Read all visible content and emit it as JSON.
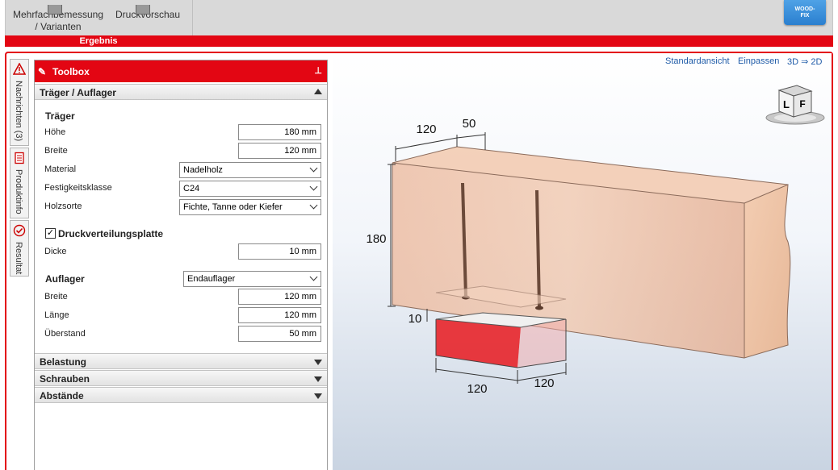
{
  "ribbon": {
    "btn_multi_line1": "Mehrfachbemessung",
    "btn_multi_line2": "/ Varianten",
    "btn_print": "Druckvorschau",
    "group_label": "Ergebnis",
    "brand_line1": "WOOD-",
    "brand_line2": "FIX"
  },
  "side_tabs": [
    {
      "label": "Nachrichten (3)",
      "icon": "warning-icon"
    },
    {
      "label": "Produktinfo",
      "icon": "document-icon"
    },
    {
      "label": "Resultat",
      "icon": "check-icon"
    }
  ],
  "toolbox": {
    "title": "Toolbox",
    "section_traeger": "Träger / Auflager",
    "traeger_heading": "Träger",
    "hoehe_label": "Höhe",
    "hoehe_value": "180 mm",
    "breite_label": "Breite",
    "breite_value": "120 mm",
    "material_label": "Material",
    "material_value": "Nadelholz",
    "festigkeit_label": "Festigkeitsklasse",
    "festigkeit_value": "C24",
    "holzsorte_label": "Holzsorte",
    "holzsorte_value": "Fichte, Tanne oder Kiefer",
    "dvp_label": "Druckverteilungsplatte",
    "dvp_checked": "✓",
    "dicke_label": "Dicke",
    "dicke_value": "10 mm",
    "auflager_heading": "Auflager",
    "auflager_value": "Endauflager",
    "a_breite_label": "Breite",
    "a_breite_value": "120 mm",
    "a_laenge_label": "Länge",
    "a_laenge_value": "120 mm",
    "a_ueberstand_label": "Überstand",
    "a_ueberstand_value": "50 mm",
    "section_belastung": "Belastung",
    "section_schrauben": "Schrauben",
    "section_abstaende": "Abstände"
  },
  "viewer": {
    "link_standard": "Standardansicht",
    "link_fit": "Einpassen",
    "link_mode": "3D ⇒ 2D",
    "cube_left": "L",
    "cube_front": "F",
    "dim_width_top": "120",
    "dim_overhang_top": "50",
    "dim_height": "180",
    "dim_plate": "10",
    "dim_support_width": "120",
    "dim_support_length": "120"
  },
  "colors": {
    "accent": "#e30613",
    "link": "#1f5ba8",
    "wood": "#eab598"
  }
}
